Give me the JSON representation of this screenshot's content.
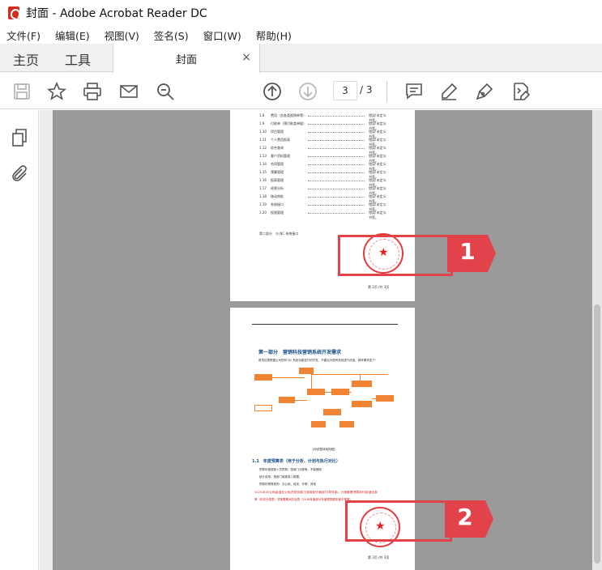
{
  "app": {
    "window_title": "封面 - Adobe Acrobat Reader DC"
  },
  "menu": [
    "文件(F)",
    "编辑(E)",
    "视图(V)",
    "签名(S)",
    "窗口(W)",
    "帮助(H)"
  ],
  "tabs": {
    "home": "主页",
    "tools": "工具",
    "document": "封面",
    "close": "×"
  },
  "toolbar": {
    "current_page": "3",
    "total_pages": "/ 3"
  },
  "icons": {
    "save": "save-icon",
    "bookmark": "star-icon",
    "print": "printer-icon",
    "email": "envelope-icon",
    "find": "search-icon",
    "prev_page": "arrow-up-circle-icon",
    "next_page": "arrow-down-circle-icon",
    "comment": "comment-icon",
    "highlight": "pen-icon",
    "sign": "sign-pen-icon",
    "edit": "edit-document-icon"
  },
  "sidebar": {
    "icons": [
      "pages-icon",
      "attachment-icon"
    ]
  },
  "page1": {
    "toc": [
      {
        "num": "1.8",
        "text": "费用（含各类报销单等）",
        "status": "错误!未定义书签。"
      },
      {
        "num": "1.9",
        "text": "付款单（预付款类单据）",
        "status": "错误!未定义书签。"
      },
      {
        "num": "1.10",
        "text": "项目管理",
        "status": "错误!未定义书签。"
      },
      {
        "num": "1.11",
        "text": "个人费用报表",
        "status": "错误!未定义书签。"
      },
      {
        "num": "1.12",
        "text": "综合查询",
        "status": "错误!未定义书签。"
      },
      {
        "num": "1.13",
        "text": "客户资料管理",
        "status": "错误!未定义书签。"
      },
      {
        "num": "1.14",
        "text": "合同管理",
        "status": "错误!未定义书签。"
      },
      {
        "num": "1.15",
        "text": "预算管理",
        "status": "错误!未定义书签。"
      },
      {
        "num": "1.16",
        "text": "报表管理",
        "status": "错误!未定义书签。"
      },
      {
        "num": "1.17",
        "text": "经营分析",
        "status": "错误!未定义书签。"
      },
      {
        "num": "1.18",
        "text": "移动审批",
        "status": "错误!未定义书签。"
      },
      {
        "num": "1.19",
        "text": "系统接口",
        "status": "错误!未定义书签。"
      },
      {
        "num": "1.20",
        "text": "权限管理",
        "status": "错误!未定义书签。"
      }
    ],
    "footer_left": "第二部分　与 NC 系统接口",
    "page_number": "第 2页 /共 3页"
  },
  "page2": {
    "section_title": "第一部分　营销科技营销系统开发需求",
    "intro": "首项目是根据公司现有 NC 系统功能进行的开发，不建议对现有系统进行改造，具体需求如下：",
    "diagram_caption": "【系统整体架构图】",
    "subsection_title": "1.1　年度预算表（用于分析、计划与执行对比）",
    "body": [
      "预算年度按照人员预算、按部门分配等。不能删除",
      "统计费用、按部门维度录入数据。",
      "预算的预算类别：办公用、培训、外联、其他"
    ],
    "body_red": [
      "①(2018)平公司级(营业公司)的财务部门(费用部分)和部门(财务部)、行销管理(预算执行部)营业部",
      "等（年初分类表）须按需期间总目表（2018年度部分年度预算额年度中等等）"
    ],
    "page_number": "第 3页 /共 3页"
  },
  "annotations": {
    "callout_1": "1",
    "callout_2": "2"
  },
  "colors": {
    "accent_red": "#e2434b",
    "stamp_red": "#e63b3b",
    "doc_background": "#9a9a9a",
    "heading_blue": "#1a4f8a",
    "diagram_orange": "#f08433"
  }
}
